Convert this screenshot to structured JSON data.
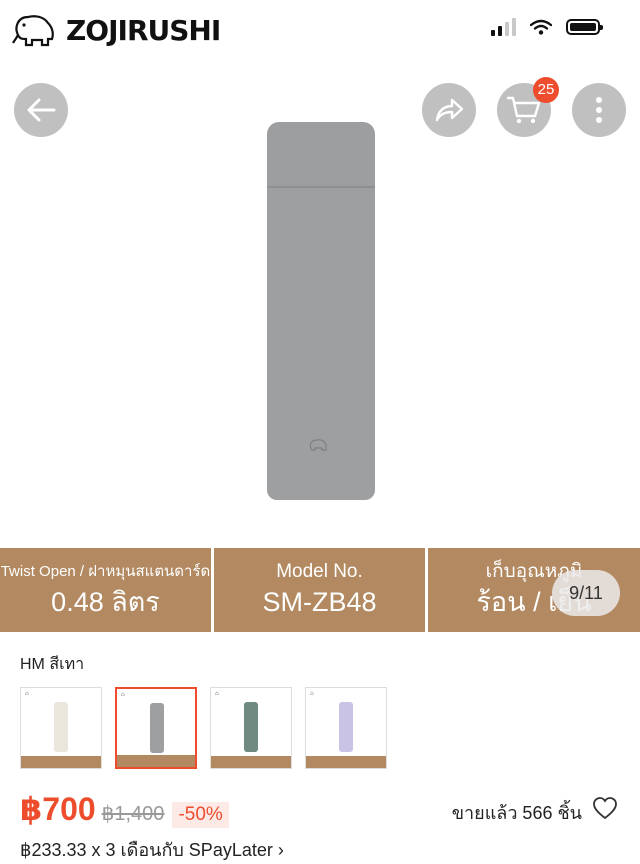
{
  "brand": {
    "name": "ZOJIRUSHI"
  },
  "status_bar": {
    "battery_level": 1.0,
    "signal_bars": 2
  },
  "toolbar": {
    "back_icon": "arrow-left-icon",
    "share_icon": "share-icon",
    "cart_icon": "cart-icon",
    "cart_count": "25",
    "more_icon": "more-vertical-icon"
  },
  "gallery": {
    "pager": "9/11"
  },
  "specs": [
    {
      "label": "Twist Open / ฝาหมุนสแตนดาร์ด",
      "value": "0.48 ลิตร"
    },
    {
      "label": "Model No.",
      "value": "SM-ZB48"
    },
    {
      "label": "เก็บอุณหภูมิ",
      "value": "ร้อน / เย็น"
    }
  ],
  "variant": {
    "selected_label": "HM สีเทา",
    "options": [
      {
        "color": "#ebe6dc"
      },
      {
        "color": "#9d9fa0"
      },
      {
        "color": "#6f8a80"
      },
      {
        "color": "#c9c3e6"
      }
    ]
  },
  "price": {
    "current": "฿700",
    "original": "฿1,400",
    "discount": "-50%",
    "sold": "ขายแล้ว 566 ชิ้น",
    "installment": "฿233.33 x 3 เดือนกับ SPayLater",
    "installment_chevron": "›"
  },
  "colors": {
    "accent": "#ee4d2d",
    "spec_bar": "#b28960"
  }
}
